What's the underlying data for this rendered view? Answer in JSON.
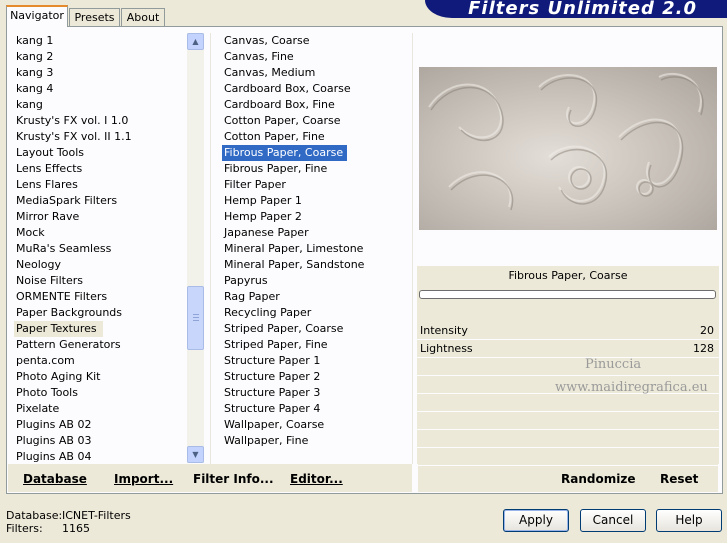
{
  "tabs": [
    {
      "label": "Navigator"
    },
    {
      "label": "Presets"
    },
    {
      "label": "About"
    }
  ],
  "banner": {
    "title": "Filters Unlimited 2.0"
  },
  "categories": [
    "kang 1",
    "kang 2",
    "kang 3",
    "kang 4",
    "kang",
    "Krusty's FX vol. I 1.0",
    "Krusty's FX vol. II 1.1",
    "Layout Tools",
    "Lens Effects",
    "Lens Flares",
    "MediaSpark Filters",
    "Mirror Rave",
    "Mock",
    "MuRa's Seamless",
    "Neology",
    "Noise Filters",
    "ORMENTE Filters",
    "Paper Backgrounds",
    "Paper Textures",
    "Pattern Generators",
    "penta.com",
    "Photo Aging Kit",
    "Photo Tools",
    "Pixelate",
    "Plugins AB 02",
    "Plugins AB 03",
    "Plugins AB 04"
  ],
  "filters": [
    "Canvas, Coarse",
    "Canvas, Fine",
    "Canvas, Medium",
    "Cardboard Box, Coarse",
    "Cardboard Box, Fine",
    "Cotton Paper, Coarse",
    "Cotton Paper, Fine",
    "Fibrous Paper, Coarse",
    "Fibrous Paper, Fine",
    "Filter Paper",
    "Hemp Paper 1",
    "Hemp Paper 2",
    "Japanese Paper",
    "Mineral Paper, Limestone",
    "Mineral Paper, Sandstone",
    "Papyrus",
    "Rag Paper",
    "Recycling Paper",
    "Striped Paper, Coarse",
    "Striped Paper, Fine",
    "Structure Paper 1",
    "Structure Paper 2",
    "Structure Paper 3",
    "Structure Paper 4",
    "Wallpaper, Coarse",
    "Wallpaper, Fine"
  ],
  "bottom_links": {
    "database": "Database",
    "import": "Import...",
    "filter_info": "Filter Info...",
    "editor": "Editor...",
    "randomize": "Randomize",
    "reset": "Reset"
  },
  "selected_filter_name": "Fibrous Paper, Coarse",
  "params": [
    {
      "label": "Intensity",
      "value": "20"
    },
    {
      "label": "Lightness",
      "value": "128"
    }
  ],
  "watermark": {
    "line1": "Pinuccia",
    "line2": "www.maidiregrafica.eu"
  },
  "status": {
    "database_label": "Database:",
    "database_value": "ICNET-Filters",
    "filters_label": "Filters:",
    "filters_value": "1165"
  },
  "buttons": {
    "apply": "Apply",
    "cancel": "Cancel",
    "help": "Help"
  },
  "icons": {
    "scroll_up": "chevron-up-icon",
    "scroll_down": "chevron-down-icon"
  }
}
